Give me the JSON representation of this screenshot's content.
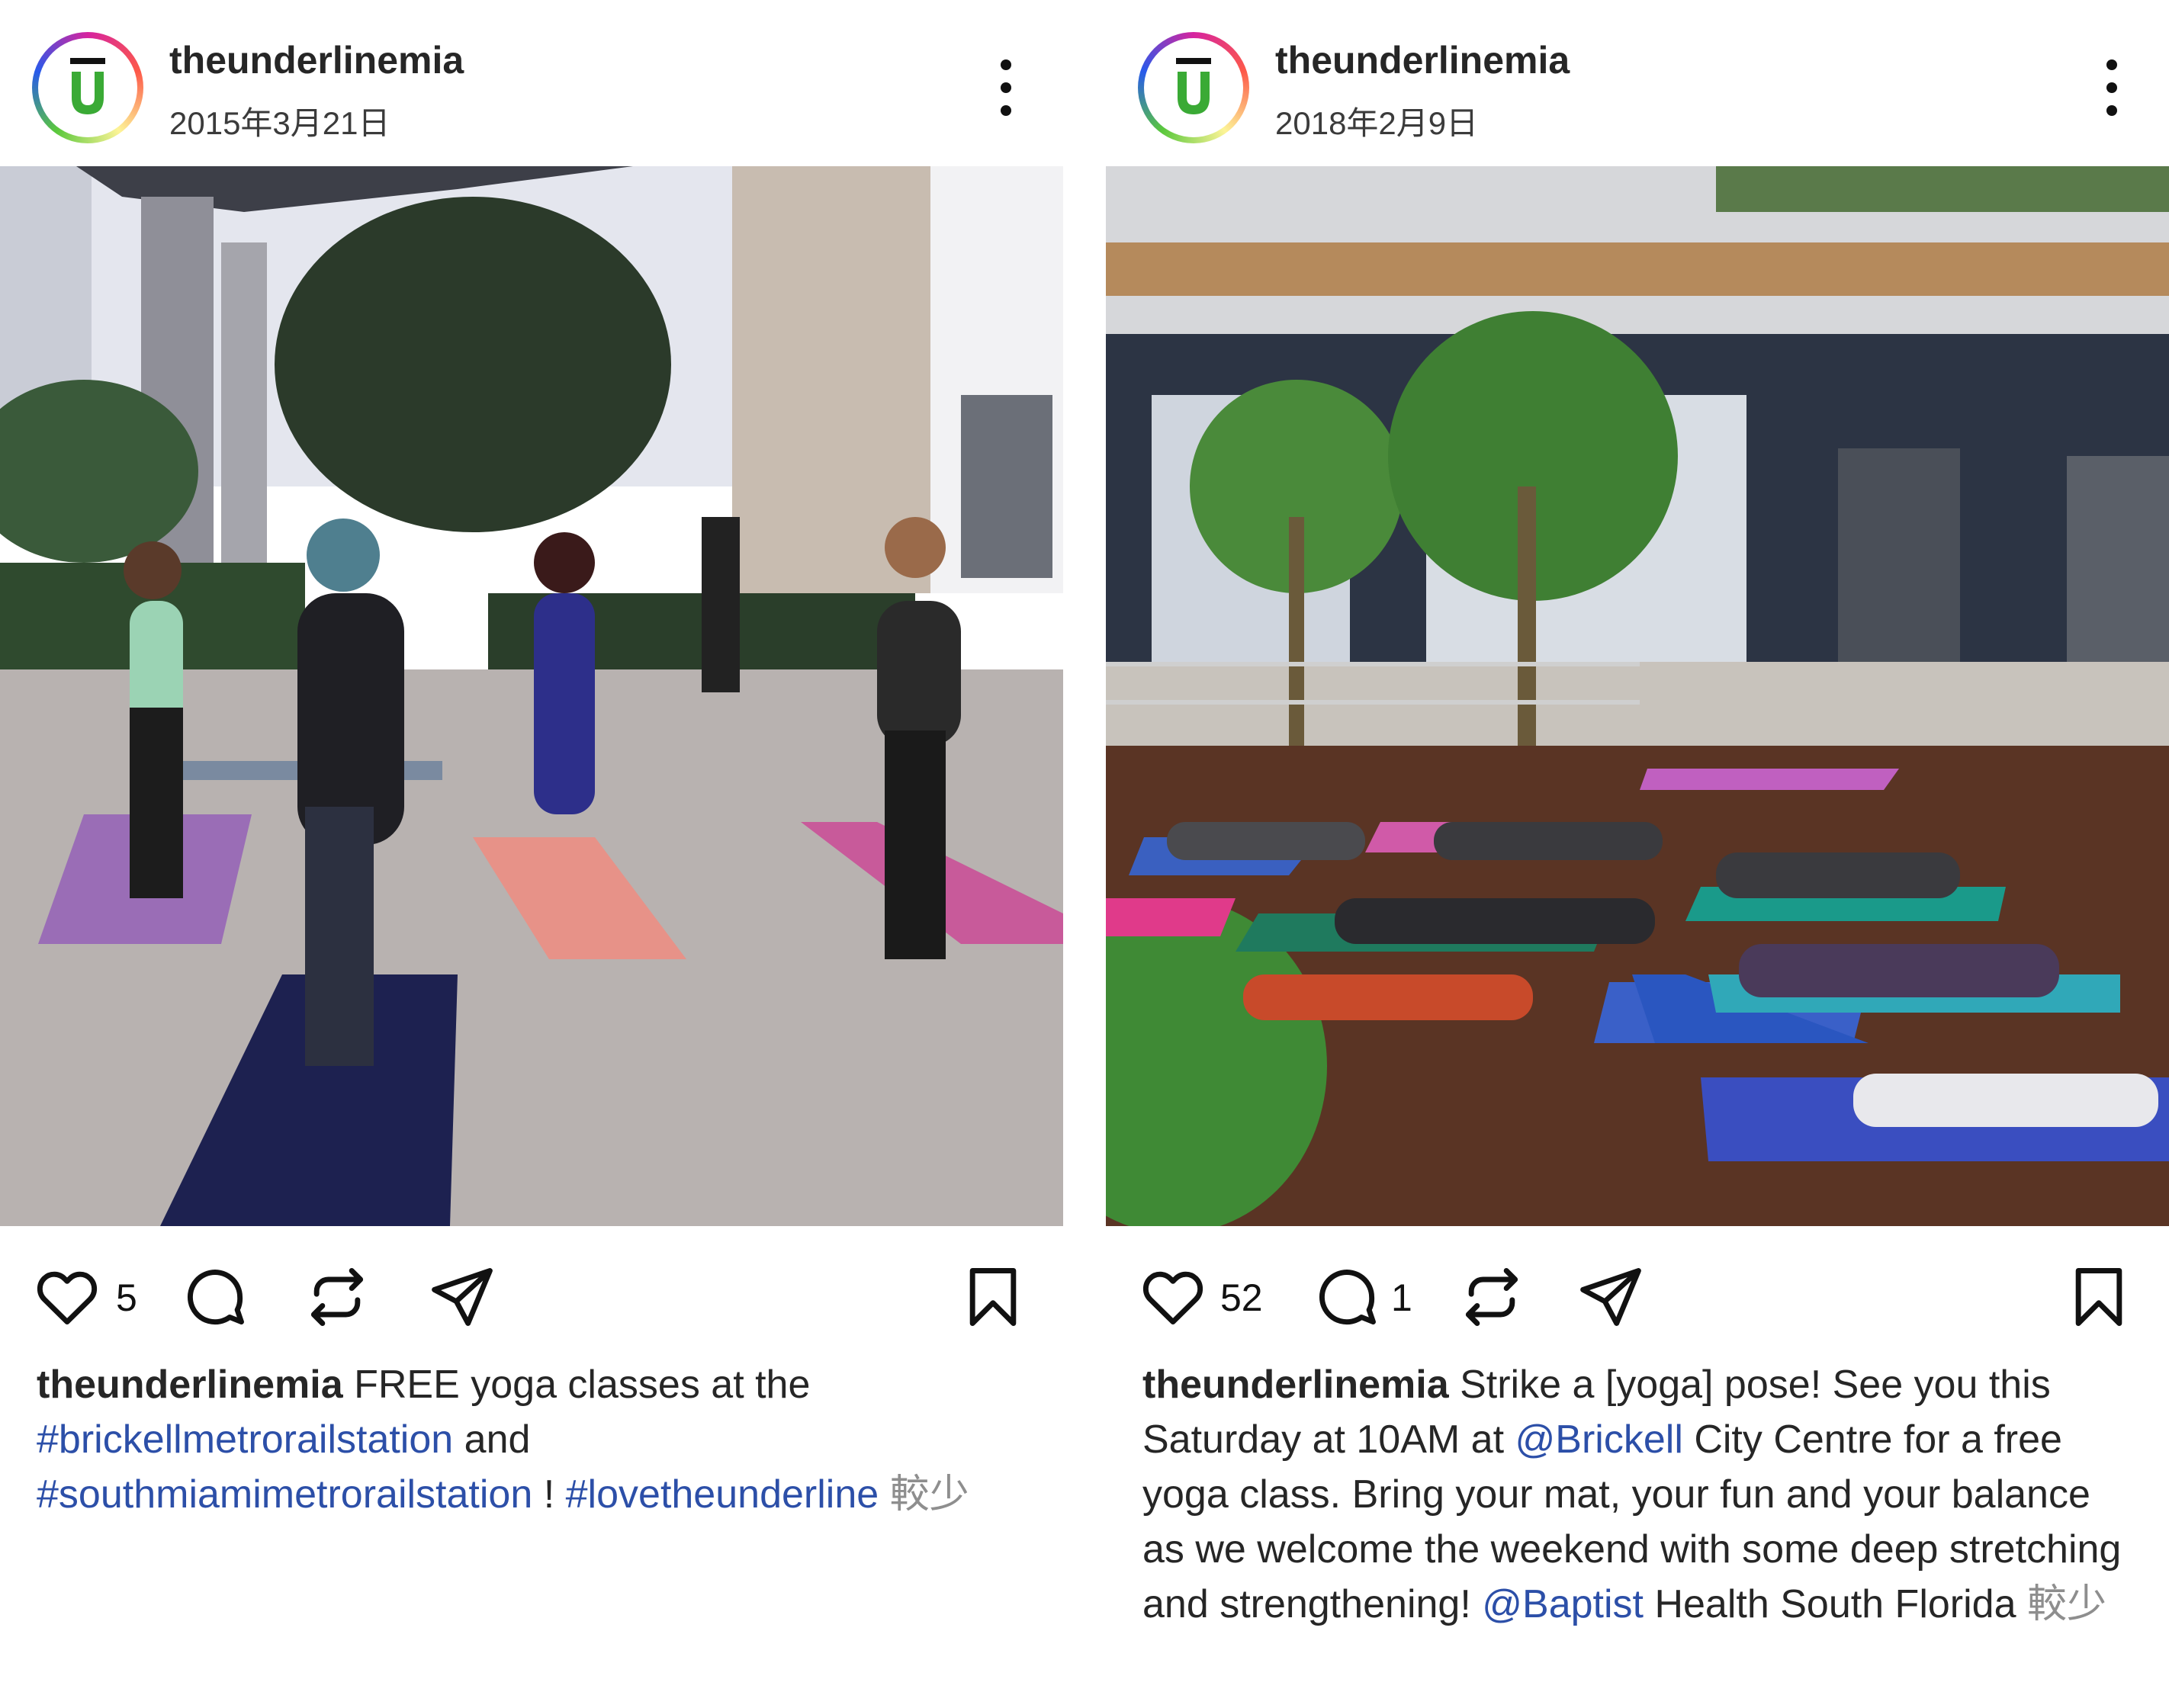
{
  "posts": [
    {
      "username": "theunderlinemia",
      "date": "2015年3月21日",
      "likes": "5",
      "comments": "",
      "caption": {
        "username": "theunderlinemia",
        "text1": "FREE yoga classes at the",
        "tag1": "#brickellmetrorailstation",
        "text2": "and",
        "tag2": "#southmiamimetrorailstation",
        "text3": "!",
        "tag3": "#lovetheunderline",
        "more": "較少"
      }
    },
    {
      "username": "theunderlinemia",
      "date": "2018年2月9日",
      "likes": "52",
      "comments": "1",
      "caption": {
        "username": "theunderlinemia",
        "text1": "Strike a [yoga] pose! See you this Saturday at 10AM at",
        "mention1": "@Brickell",
        "text2": "City Centre for a free yoga class. Bring your mat, your fun and your balance as we welcome the weekend with some deep stretching and strengthening!",
        "mention2": "@Baptist",
        "text3": "Health South Florida",
        "more": "較少"
      }
    }
  ],
  "icons": [
    "heart-icon",
    "comment-icon",
    "repost-icon",
    "share-icon",
    "bookmark-icon",
    "more-options-icon"
  ],
  "colors": {
    "link": "#2c4fa8",
    "logo_green": "#3aaa35",
    "text": "#262626"
  }
}
